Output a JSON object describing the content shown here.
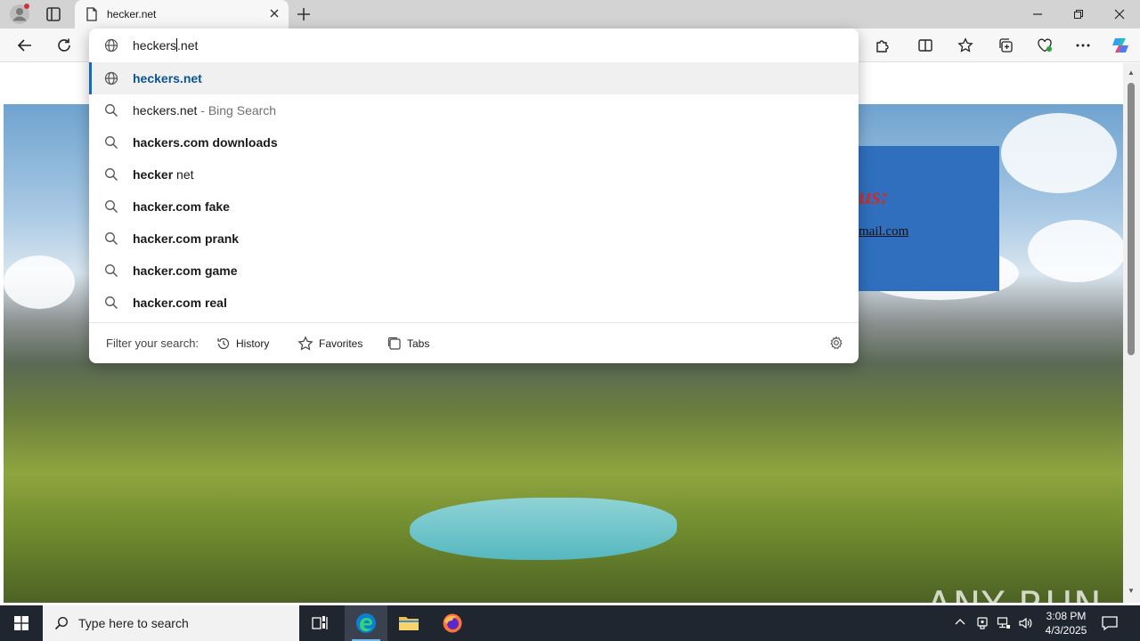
{
  "browser": {
    "tab": {
      "title": "hecker.net"
    },
    "omnibox": {
      "value_typed": "heckers",
      "value_rest": "net"
    },
    "suggestions": [
      {
        "bold": "heckers.net",
        "rest": "",
        "sub": "",
        "icon": "globe-icon",
        "selected": true
      },
      {
        "bold": "",
        "rest": "heckers.net",
        "sub": " - Bing Search",
        "icon": "search-icon",
        "selected": false
      },
      {
        "bold": "hackers.com downloads",
        "rest": "",
        "sub": "",
        "icon": "search-icon",
        "selected": false
      },
      {
        "bold": "hecker",
        "rest": " net",
        "sub": "",
        "icon": "search-icon",
        "selected": false
      },
      {
        "bold": "hacker.com fake",
        "rest": "",
        "sub": "",
        "icon": "search-icon",
        "selected": false
      },
      {
        "bold": "hacker.com prank",
        "rest": "",
        "sub": "",
        "icon": "search-icon",
        "selected": false
      },
      {
        "bold": "hacker.com game",
        "rest": "",
        "sub": "",
        "icon": "search-icon",
        "selected": false
      },
      {
        "bold": "hacker.com real",
        "rest": "",
        "sub": "",
        "icon": "search-icon",
        "selected": false
      }
    ],
    "filter": {
      "label": "Filter your search:",
      "history": "History",
      "favorites": "Favorites",
      "tabs": "Tabs"
    }
  },
  "page": {
    "contact_heading": "us:",
    "contact_email": "mail.com",
    "watermark": "ANY RUN"
  },
  "taskbar": {
    "search_placeholder": "Type here to search",
    "time": "3:08 PM",
    "date": "4/3/2025"
  },
  "colors": {
    "accent": "#0f6cbd",
    "contact_box": "#2f6fbd",
    "contact_heading": "#c7302f",
    "taskbar": "#1f2630"
  }
}
